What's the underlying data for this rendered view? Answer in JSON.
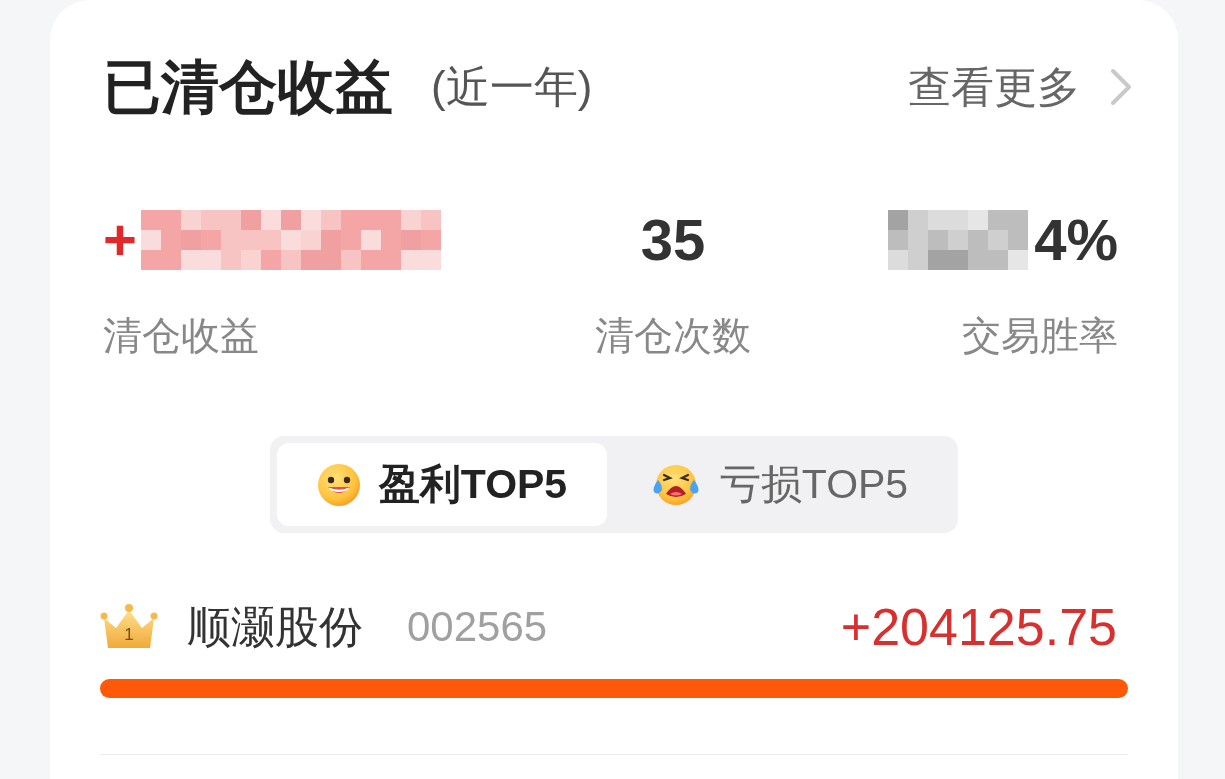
{
  "header": {
    "title": "已清仓收益",
    "subtitle": "(近一年)",
    "more_link": "查看更多"
  },
  "stats": [
    {
      "kind": "profit",
      "value": "+",
      "redacted": true,
      "label": "清仓收益"
    },
    {
      "kind": "count",
      "value": "35",
      "redacted": false,
      "label": "清仓次数"
    },
    {
      "kind": "rate",
      "value": "4%",
      "redacted": true,
      "label": "交易胜率"
    }
  ],
  "tabs": [
    {
      "kind": "profit",
      "label": "盈利TOP5",
      "selected": true
    },
    {
      "kind": "loss",
      "label": "亏损TOP5",
      "selected": false
    }
  ],
  "rows": [
    {
      "rank": "1",
      "name": "顺灏股份",
      "code": "002565",
      "amount": "+204125.75",
      "level": 1
    }
  ]
}
